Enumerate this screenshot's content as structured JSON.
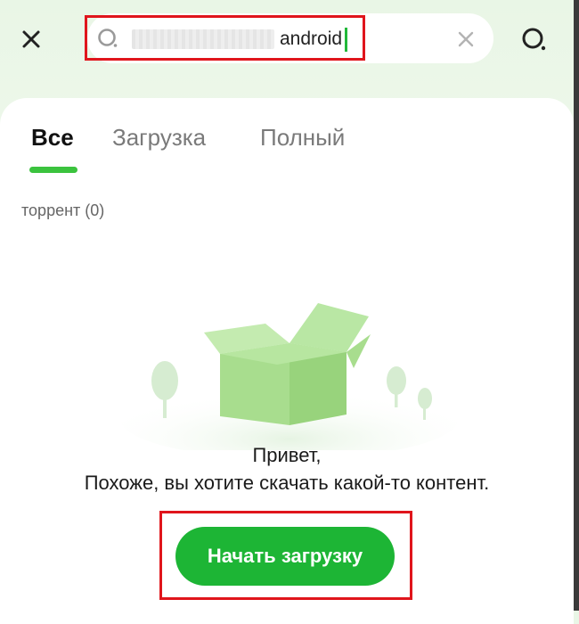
{
  "search": {
    "query": "android",
    "icons": {
      "close": "close-icon",
      "search": "search-icon",
      "clear": "clear-icon"
    }
  },
  "tabs": [
    {
      "label": "Все",
      "active": true
    },
    {
      "label": "Загрузка",
      "active": false
    },
    {
      "label": "Полный",
      "active": false
    }
  ],
  "results": {
    "count_label": "торрент (0)"
  },
  "empty_state": {
    "line1": "Привет,",
    "line2": "Похоже, вы хотите скачать какой-то контент.",
    "button": "Начать загрузку"
  },
  "colors": {
    "accent": "#1db535",
    "tab_indicator": "#3bc33e",
    "highlight": "#e0151c"
  }
}
